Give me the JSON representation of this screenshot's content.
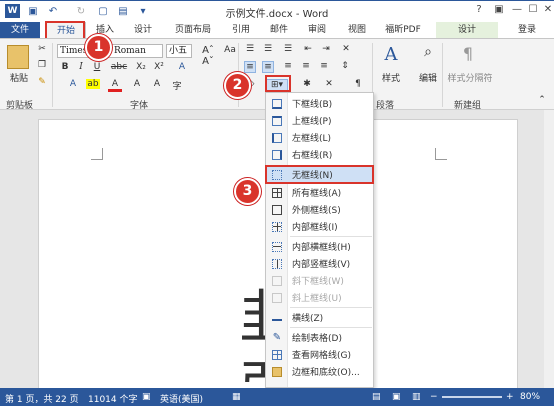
{
  "window": {
    "title": "示例文件.docx - Word",
    "controls": {
      "help": "?",
      "restore": "▣",
      "minimize": "—",
      "maximize": "☐",
      "close": "✕"
    },
    "quick_access": {
      "save_icon": "save-icon",
      "undo_icon": "undo-icon",
      "redo_icon": "redo-icon",
      "new_icon": "new-doc-icon",
      "open_icon": "open-icon"
    }
  },
  "tabs": [
    "文件",
    "开始",
    "插入",
    "设计",
    "页面布局",
    "引用",
    "邮件",
    "审阅",
    "视图",
    "福昕PDF",
    "设计",
    "登录"
  ],
  "ribbon": {
    "clipboard": {
      "paste": "粘贴",
      "label": "剪贴板"
    },
    "font": {
      "name": "Times New Roman",
      "size": "小五",
      "label": "字体",
      "bold": "B",
      "italic": "I",
      "underline": "U",
      "strike": "abc",
      "sub": "X₂",
      "sup": "X²"
    },
    "paragraph": {
      "label": "段落"
    },
    "styles": {
      "label": "样式"
    },
    "editing": {
      "label": "编辑"
    },
    "newgroup": {
      "btn": "样式分隔符",
      "label": "新建组"
    }
  },
  "steps": [
    "1",
    "2",
    "3"
  ],
  "menu": {
    "items": [
      {
        "label": "下框线(B)",
        "disabled": false
      },
      {
        "label": "上框线(P)",
        "disabled": false
      },
      {
        "label": "左框线(L)",
        "disabled": false
      },
      {
        "label": "右框线(R)",
        "disabled": false
      },
      {
        "label": "无框线(N)",
        "disabled": false,
        "selected": true
      },
      {
        "label": "所有框线(A)",
        "disabled": false
      },
      {
        "label": "外侧框线(S)",
        "disabled": false
      },
      {
        "label": "内部框线(I)",
        "disabled": false
      },
      {
        "label": "内部横框线(H)",
        "disabled": false
      },
      {
        "label": "内部竖框线(V)",
        "disabled": false
      },
      {
        "label": "斜下框线(W)",
        "disabled": true
      },
      {
        "label": "斜上框线(U)",
        "disabled": true
      },
      {
        "label": "横线(Z)",
        "disabled": false
      },
      {
        "label": "绘制表格(D)",
        "disabled": false
      },
      {
        "label": "查看网格线(G)",
        "disabled": false
      },
      {
        "label": "边框和底纹(O)...",
        "disabled": false
      }
    ]
  },
  "document": {
    "chars": [
      "韭",
      "弱"
    ]
  },
  "status": {
    "page": "第 1 页，共 22 页",
    "words": "11014 个字",
    "lang": "英语(美国)",
    "zoom": "80%"
  }
}
